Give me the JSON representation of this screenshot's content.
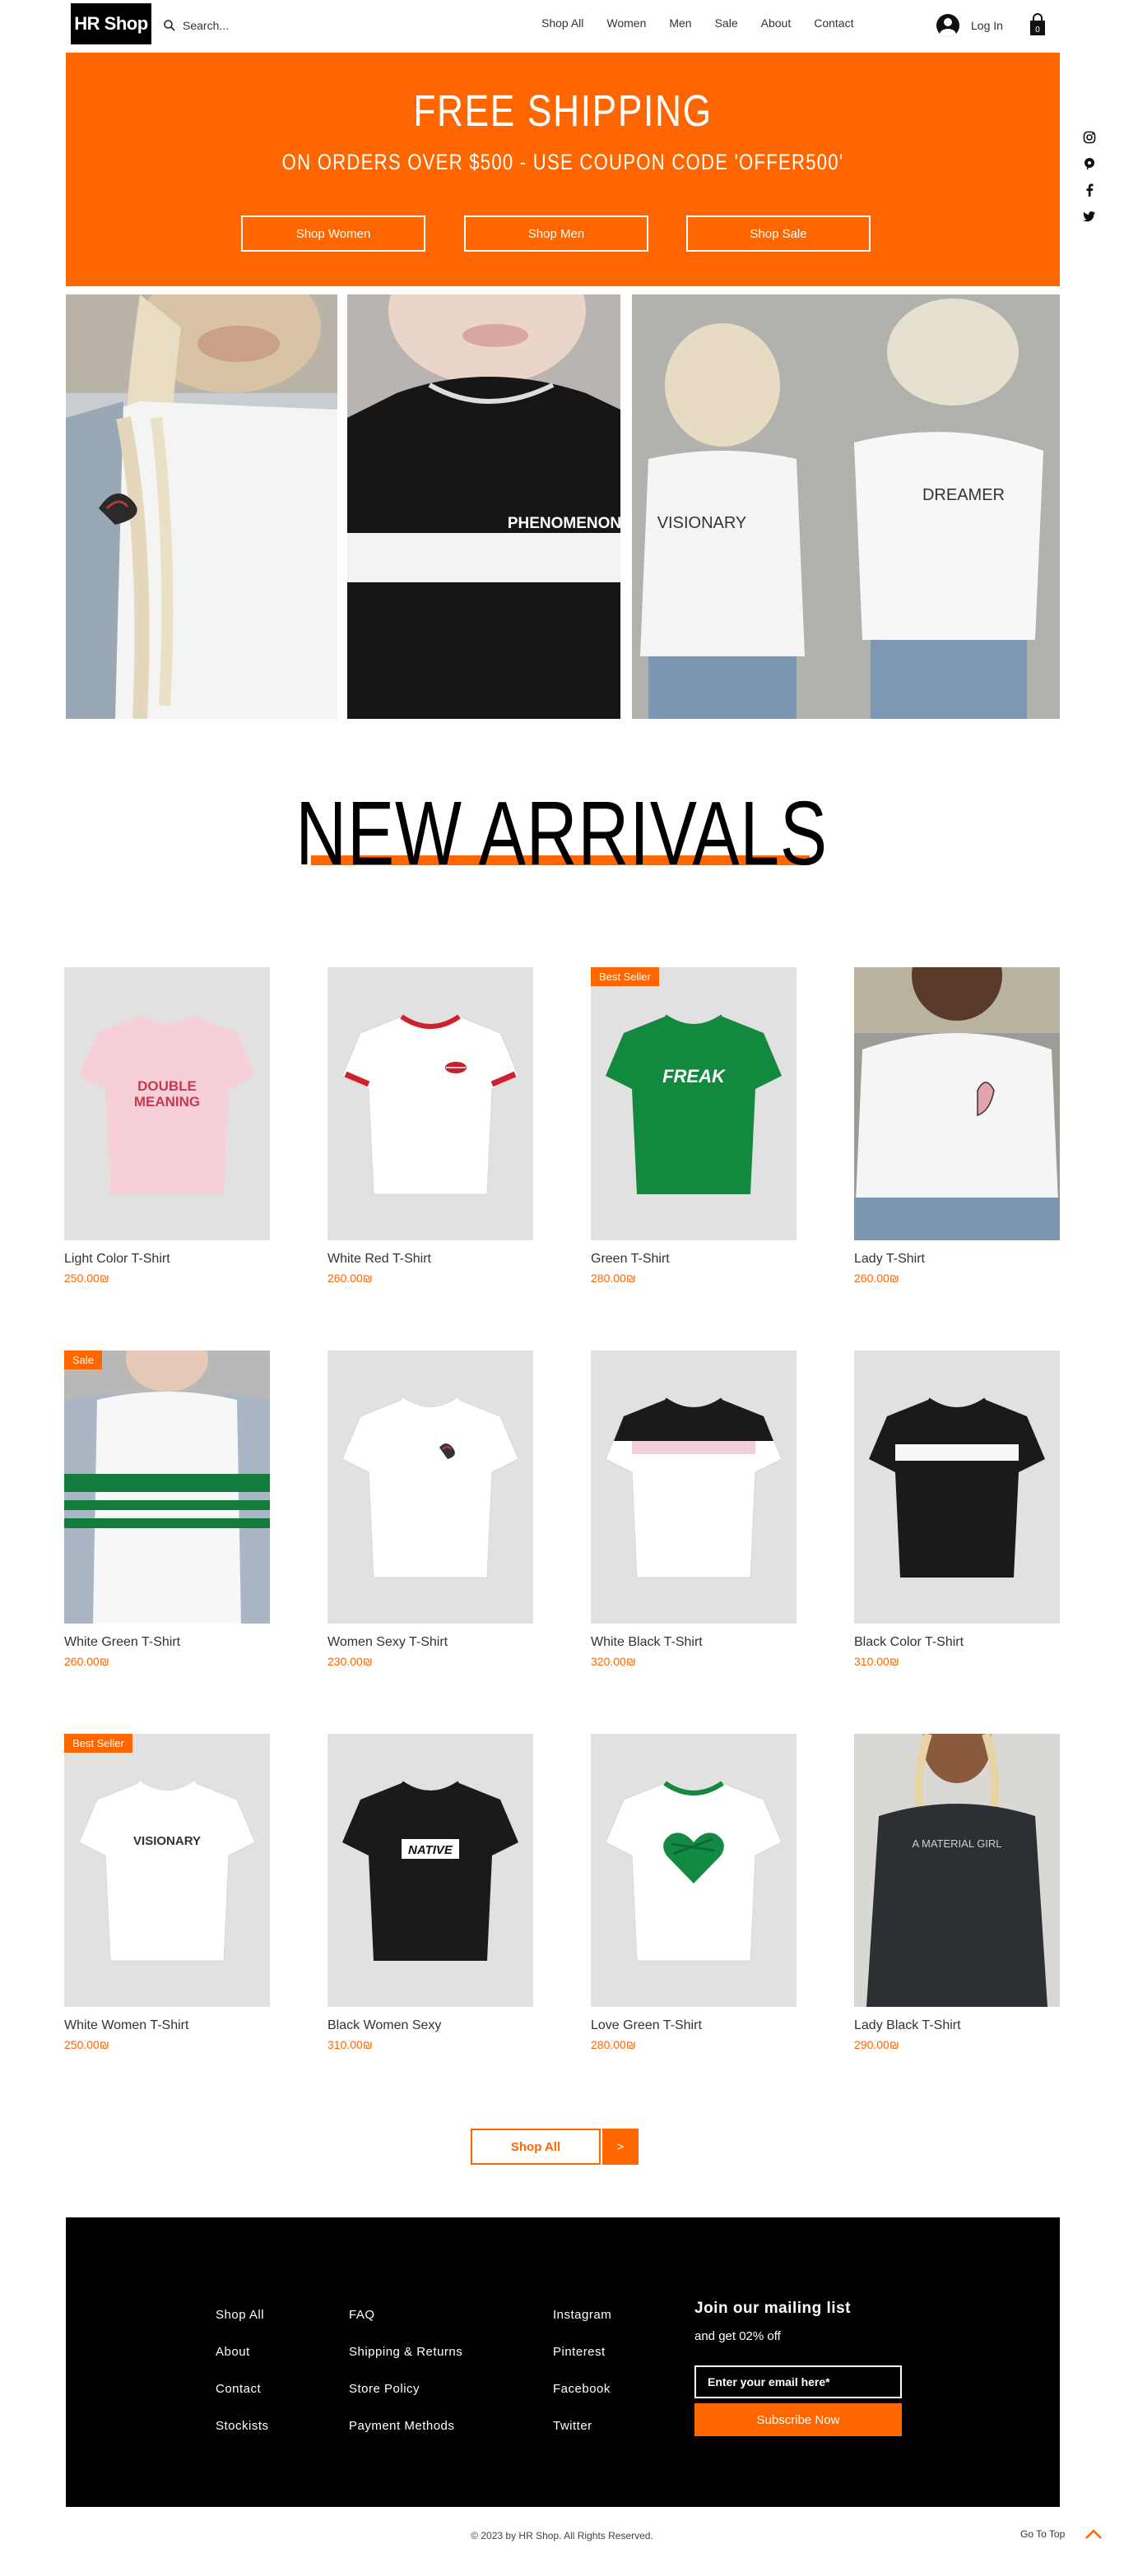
{
  "header": {
    "logo": "HR Shop",
    "search_placeholder": "Search...",
    "nav": [
      "Shop All",
      "Women",
      "Men",
      "Sale",
      "About",
      "Contact"
    ],
    "login_label": "Log In",
    "cart_count": "0"
  },
  "banner": {
    "title": "FREE SHIPPING",
    "subtitle": "ON ORDERS OVER $500 - USE COUPON CODE 'OFFER500'",
    "buttons": [
      "Shop Women",
      "Shop Men",
      "Shop Sale"
    ],
    "background": "#ff6600"
  },
  "hero_images": {
    "left_shirt_print": "",
    "middle_shirt_text": "PHENOMENON",
    "right_shirt_text_1": "VISIONARY",
    "right_shirt_text_2": "DREAMER"
  },
  "social": [
    "instagram-icon",
    "pinterest-icon",
    "facebook-icon",
    "twitter-icon"
  ],
  "new_arrivals": {
    "title": "NEW ARRIVALS",
    "accent": "#ff6600"
  },
  "products": [
    {
      "name": "Light Color T-Shirt",
      "price": "250.00₪",
      "badge": "",
      "shirt_text": "DOUBLE\nMEANING"
    },
    {
      "name": "White Red T-Shirt",
      "price": "260.00₪",
      "badge": "",
      "shirt_text": ""
    },
    {
      "name": "Green T-Shirt",
      "price": "280.00₪",
      "badge": "Best Seller",
      "shirt_text": "FREAK"
    },
    {
      "name": "Lady T-Shirt",
      "price": "260.00₪",
      "badge": "",
      "shirt_text": ""
    },
    {
      "name": "White Green T-Shirt",
      "price": "260.00₪",
      "badge": "Sale",
      "shirt_text": ""
    },
    {
      "name": "Women Sexy T-Shirt",
      "price": "230.00₪",
      "badge": "",
      "shirt_text": ""
    },
    {
      "name": "White Black T-Shirt",
      "price": "320.00₪",
      "badge": "",
      "shirt_text": ""
    },
    {
      "name": "Black Color T-Shirt",
      "price": "310.00₪",
      "badge": "",
      "shirt_text": ""
    },
    {
      "name": "White Women T-Shirt",
      "price": "250.00₪",
      "badge": "Best Seller",
      "shirt_text": "VISIONARY"
    },
    {
      "name": "Black Women Sexy",
      "price": "310.00₪",
      "badge": "",
      "shirt_text": "NATIVE"
    },
    {
      "name": "Love Green T-Shirt",
      "price": "280.00₪",
      "badge": "",
      "shirt_text": ""
    },
    {
      "name": "Lady Black T-Shirt",
      "price": "290.00₪",
      "badge": "",
      "shirt_text": "A MATERIAL GIRL"
    }
  ],
  "shop_all": {
    "label": "Shop All",
    "next_label": ">"
  },
  "footer": {
    "col1": [
      "Shop All",
      "About",
      "Contact",
      "Stockists"
    ],
    "col2": [
      "FAQ",
      "Shipping & Returns",
      "Store Policy",
      "Payment Methods"
    ],
    "col3": [
      "Instagram",
      "Pinterest",
      "Facebook",
      "Twitter"
    ],
    "mailing_title": "Join our mailing list",
    "mailing_sub": "and get 02% off",
    "email_placeholder": "Enter your email here*",
    "subscribe_label": "Subscribe Now"
  },
  "copyright": "© 2023 by HR Shop. All Rights Reserved.",
  "go_to_top": "Go To Top"
}
